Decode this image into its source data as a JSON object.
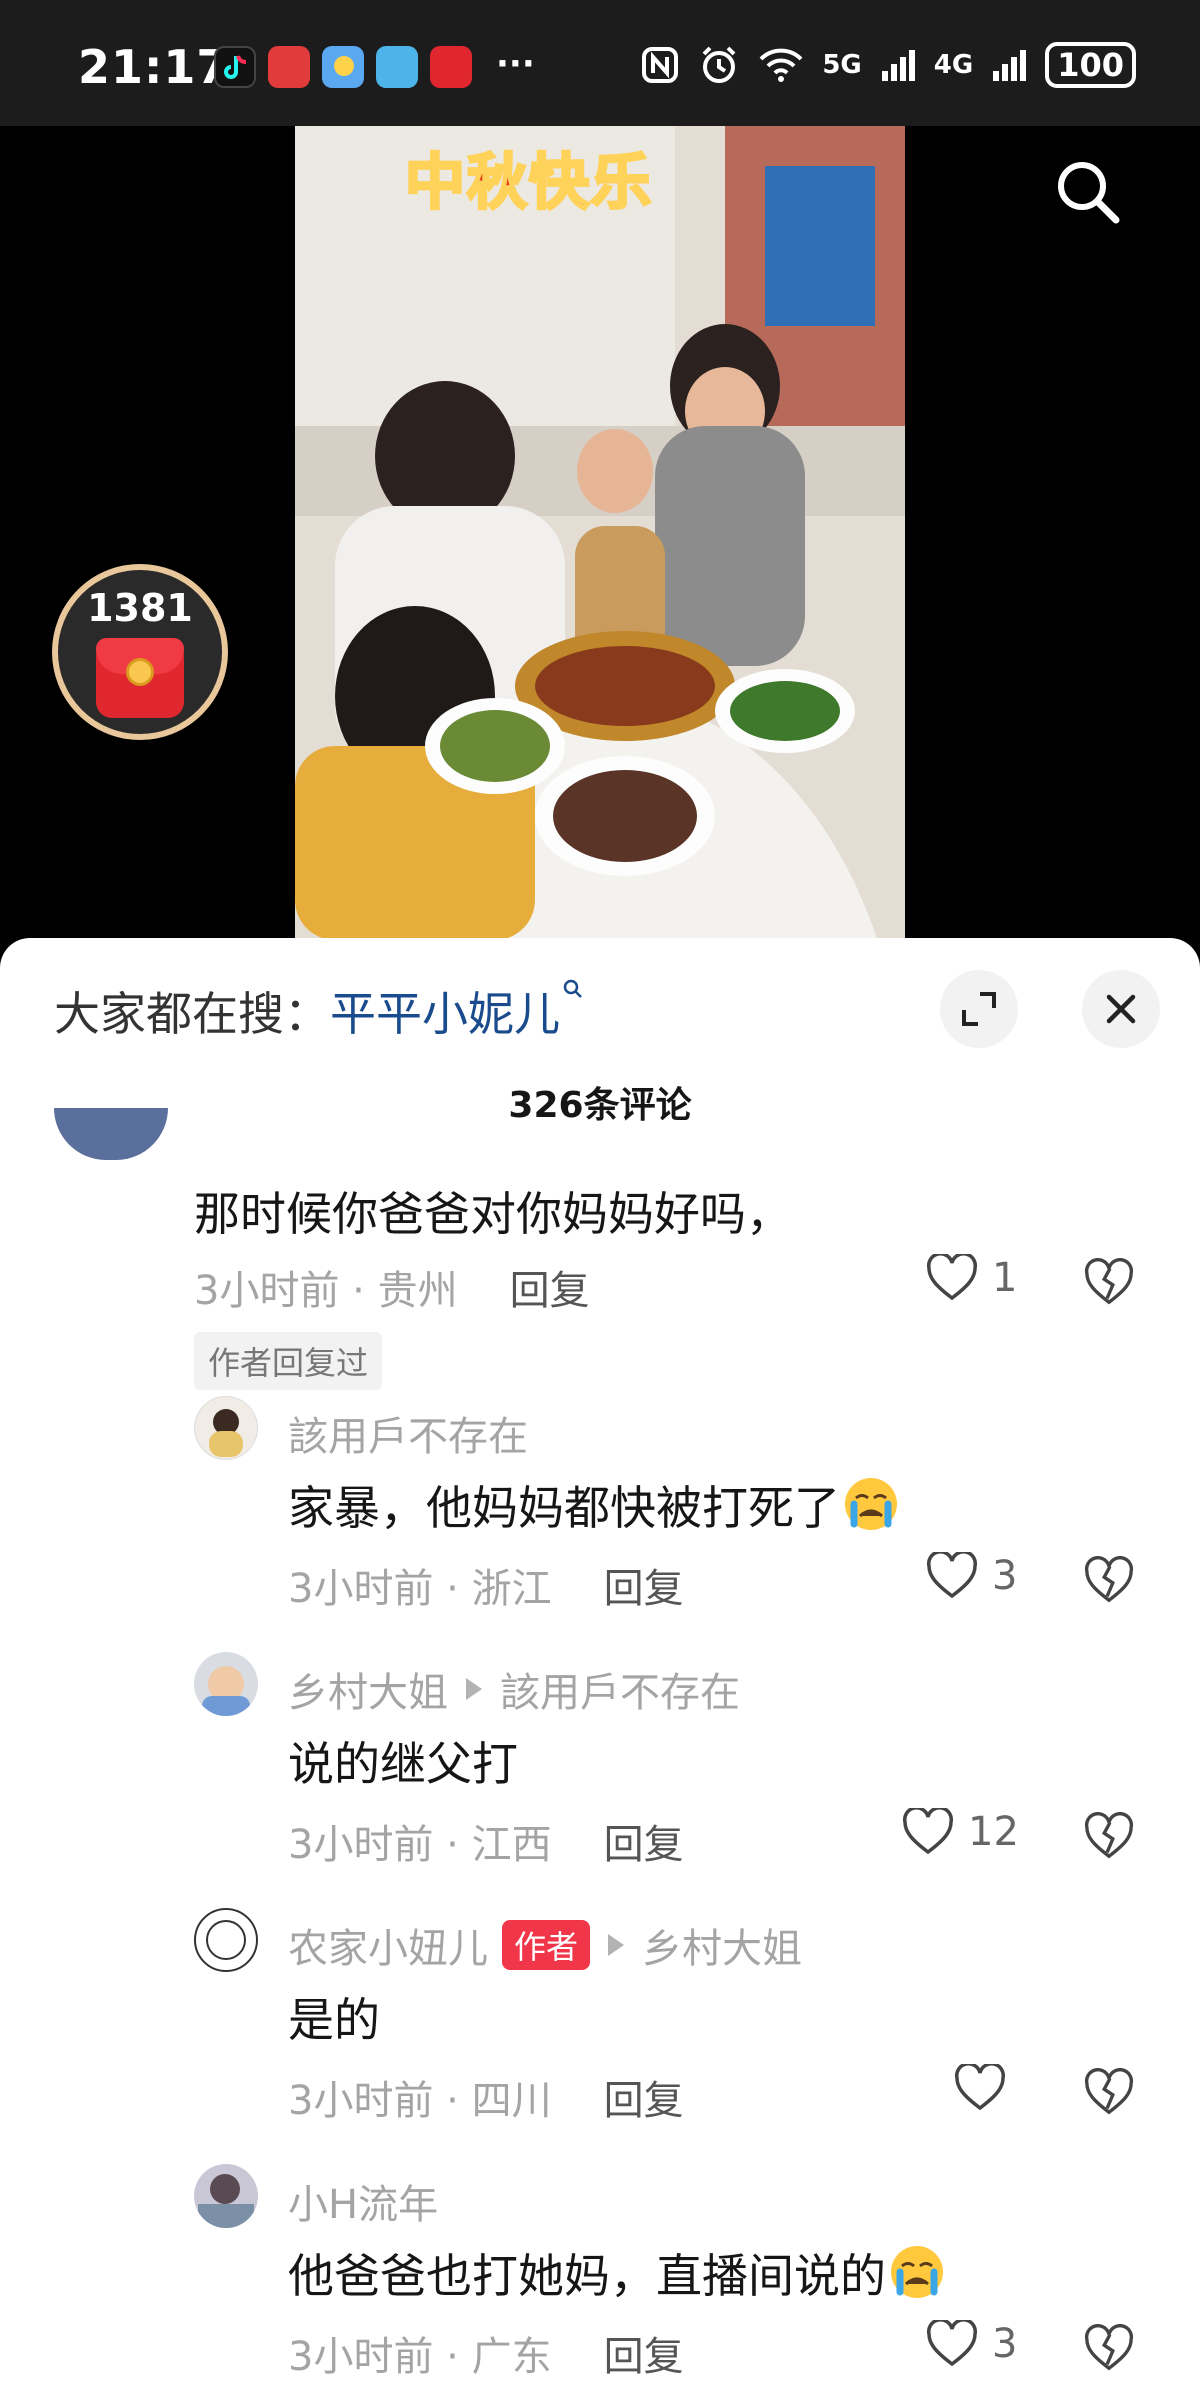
{
  "status_bar": {
    "time": "21:17",
    "battery": "100",
    "signal_a": "5G",
    "signal_b": "4G",
    "more": "···"
  },
  "video": {
    "overlay_title": "中秋快乐"
  },
  "red_packet": {
    "count": "1381"
  },
  "panel": {
    "hot_search_label": "大家都在搜：",
    "hot_search_term": "平平小妮儿",
    "comment_count": "326条评论"
  },
  "comments": [
    {
      "text": "那时候你爸爸对你妈妈好吗，",
      "time_loc": "3小时前 · 贵州",
      "reply_label": "回复",
      "likes": "1",
      "tag": "作者回复过"
    },
    {
      "user": "該用戶不存在",
      "text": "家暴，他妈妈都快被打死了",
      "time_loc": "3小时前 · 浙江",
      "reply_label": "回复",
      "likes": "3"
    },
    {
      "user": "乡村大姐",
      "reply_to": "該用戶不存在",
      "text": "说的继父打",
      "time_loc": "3小时前 · 江西",
      "reply_label": "回复",
      "likes": "12"
    },
    {
      "user": "农家小妞儿",
      "badge": "作者",
      "reply_to": "乡村大姐",
      "text": "是的",
      "time_loc": "3小时前 · 四川",
      "reply_label": "回复",
      "likes": ""
    },
    {
      "user": "小H流年",
      "text": "他爸爸也打她妈，直播间说的",
      "time_loc": "3小时前 · 广东",
      "reply_label": "回复",
      "likes": "3"
    }
  ],
  "colors": {
    "accent_red": "#f2364a",
    "link_blue": "#1a4b8c",
    "meta_gray": "#a4a4a4"
  },
  "icons": [
    "search-icon",
    "expand-icon",
    "close-icon",
    "heart-icon",
    "broken-heart-icon",
    "crying-emoji-icon",
    "red-packet-icon"
  ]
}
